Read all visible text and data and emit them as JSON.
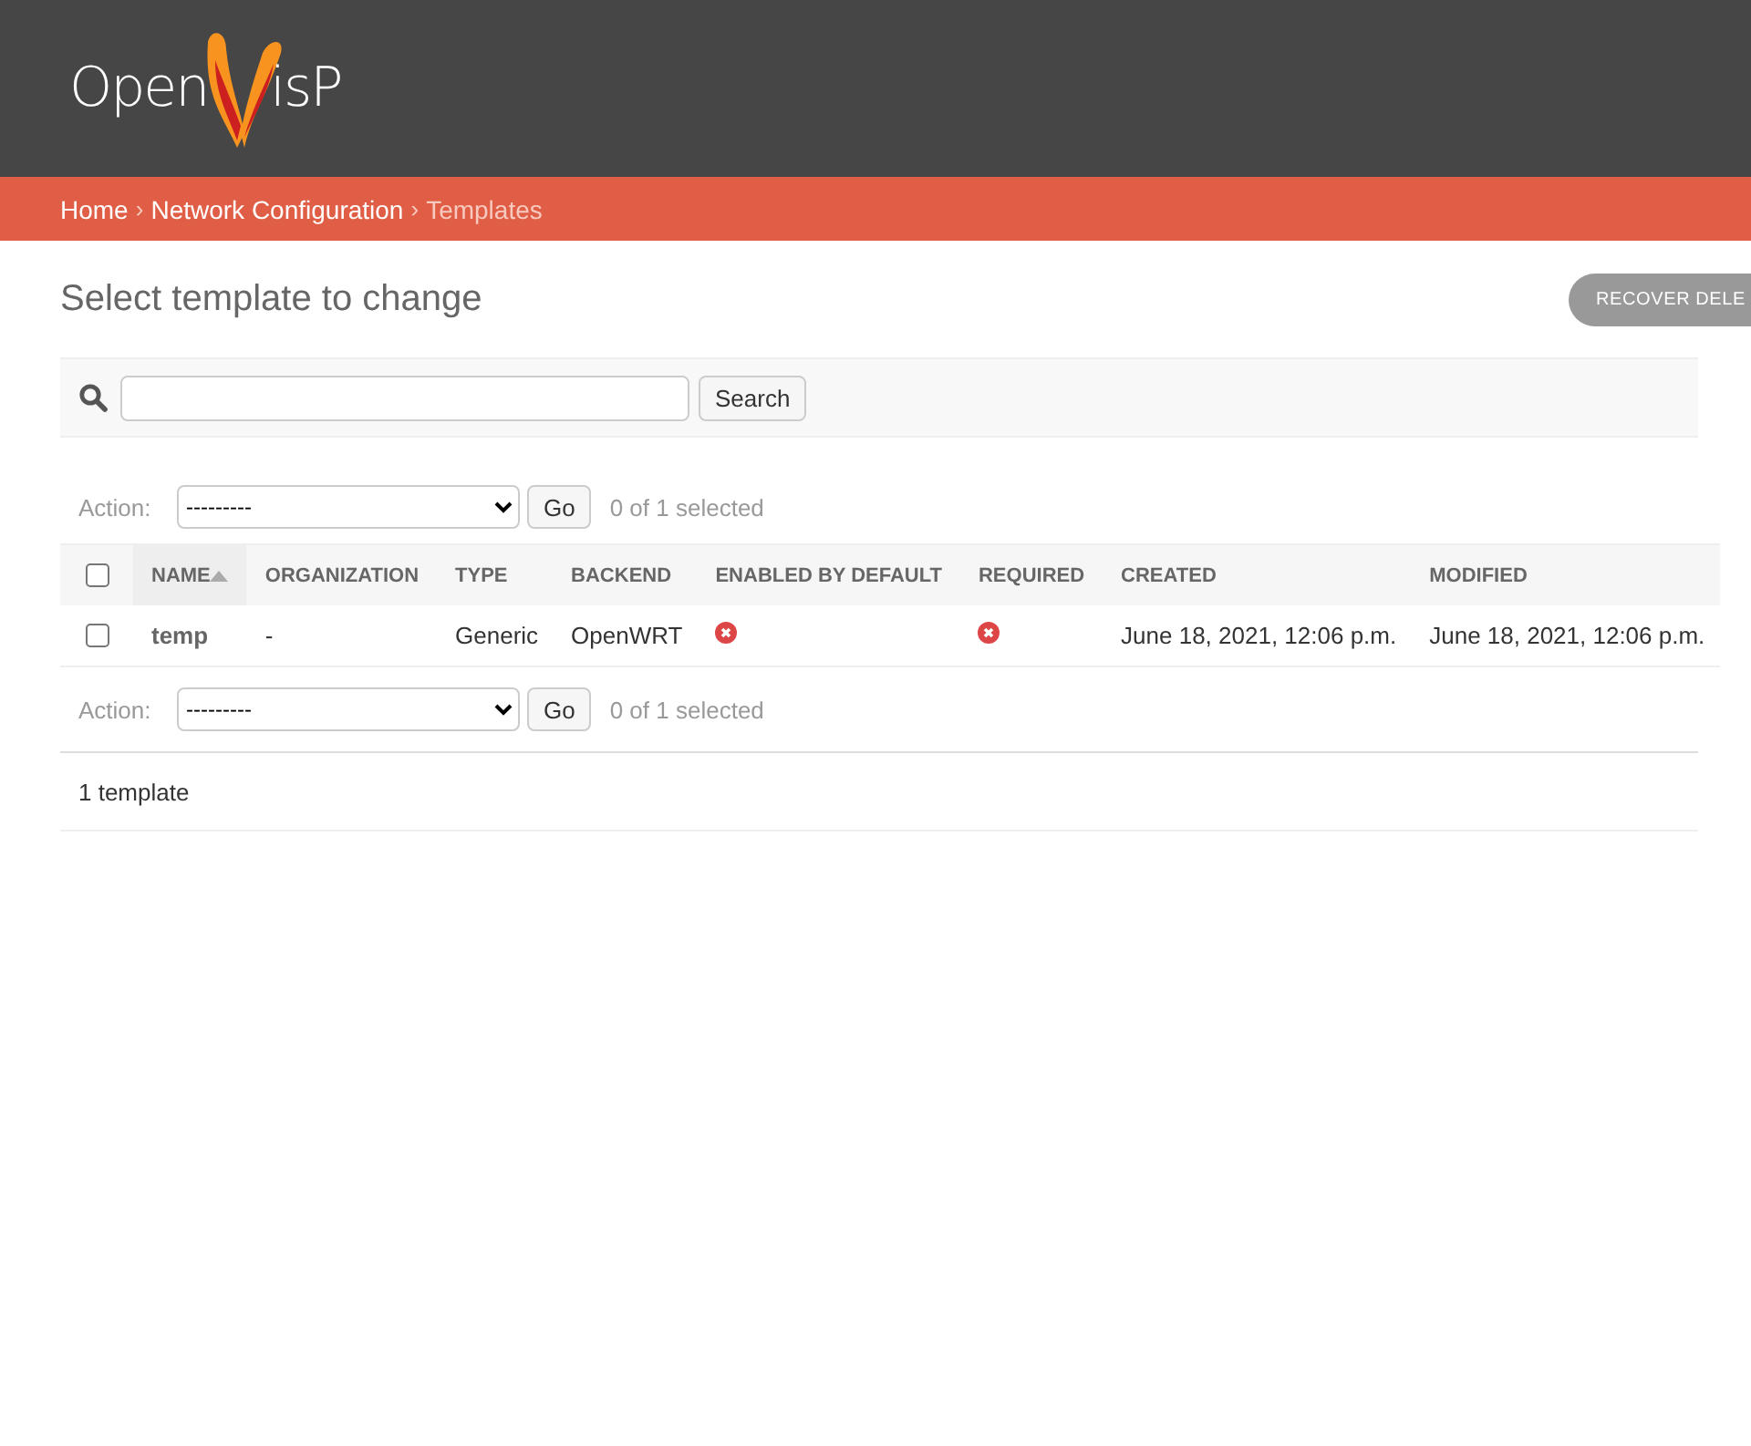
{
  "header": {
    "logo_left": "Open",
    "logo_right": "isP"
  },
  "breadcrumb_separator": "›",
  "breadcrumbs": [
    {
      "label": "Home",
      "current": false
    },
    {
      "label": "Network Configuration",
      "current": false
    },
    {
      "label": "Templates",
      "current": true
    }
  ],
  "title": "Select template to change",
  "recover_button": "RECOVER DELE",
  "search": {
    "button": "Search"
  },
  "actions_top": {
    "label": "Action:",
    "option": "---------",
    "go": "Go",
    "counter": "0 of 1 selected"
  },
  "table": {
    "select_all_checked": false,
    "columns": [
      {
        "label": "NAME",
        "sorted": true
      },
      {
        "label": "ORGANIZATION",
        "sorted": false
      },
      {
        "label": "TYPE",
        "sorted": false
      },
      {
        "label": "BACKEND",
        "sorted": false
      },
      {
        "label": "ENABLED BY DEFAULT",
        "sorted": false
      },
      {
        "label": "REQUIRED",
        "sorted": false
      },
      {
        "label": "CREATED",
        "sorted": false
      },
      {
        "label": "MODIFIED",
        "sorted": false
      }
    ],
    "rows": [
      {
        "checked": false,
        "cells": [
          {
            "kind": "link",
            "text": "temp"
          },
          {
            "kind": "text",
            "text": "-"
          },
          {
            "kind": "text",
            "text": "Generic"
          },
          {
            "kind": "text",
            "text": "OpenWRT"
          },
          {
            "kind": "boolean",
            "value": false
          },
          {
            "kind": "boolean",
            "value": false
          },
          {
            "kind": "text",
            "text": "June 18, 2021, 12:06 p.m."
          },
          {
            "kind": "text",
            "text": "June 18, 2021, 12:06 p.m."
          }
        ]
      }
    ]
  },
  "actions_bottom": {
    "label": "Action:",
    "option": "---------",
    "go": "Go",
    "counter": "0 of 1 selected"
  },
  "paginator": "1 template"
}
